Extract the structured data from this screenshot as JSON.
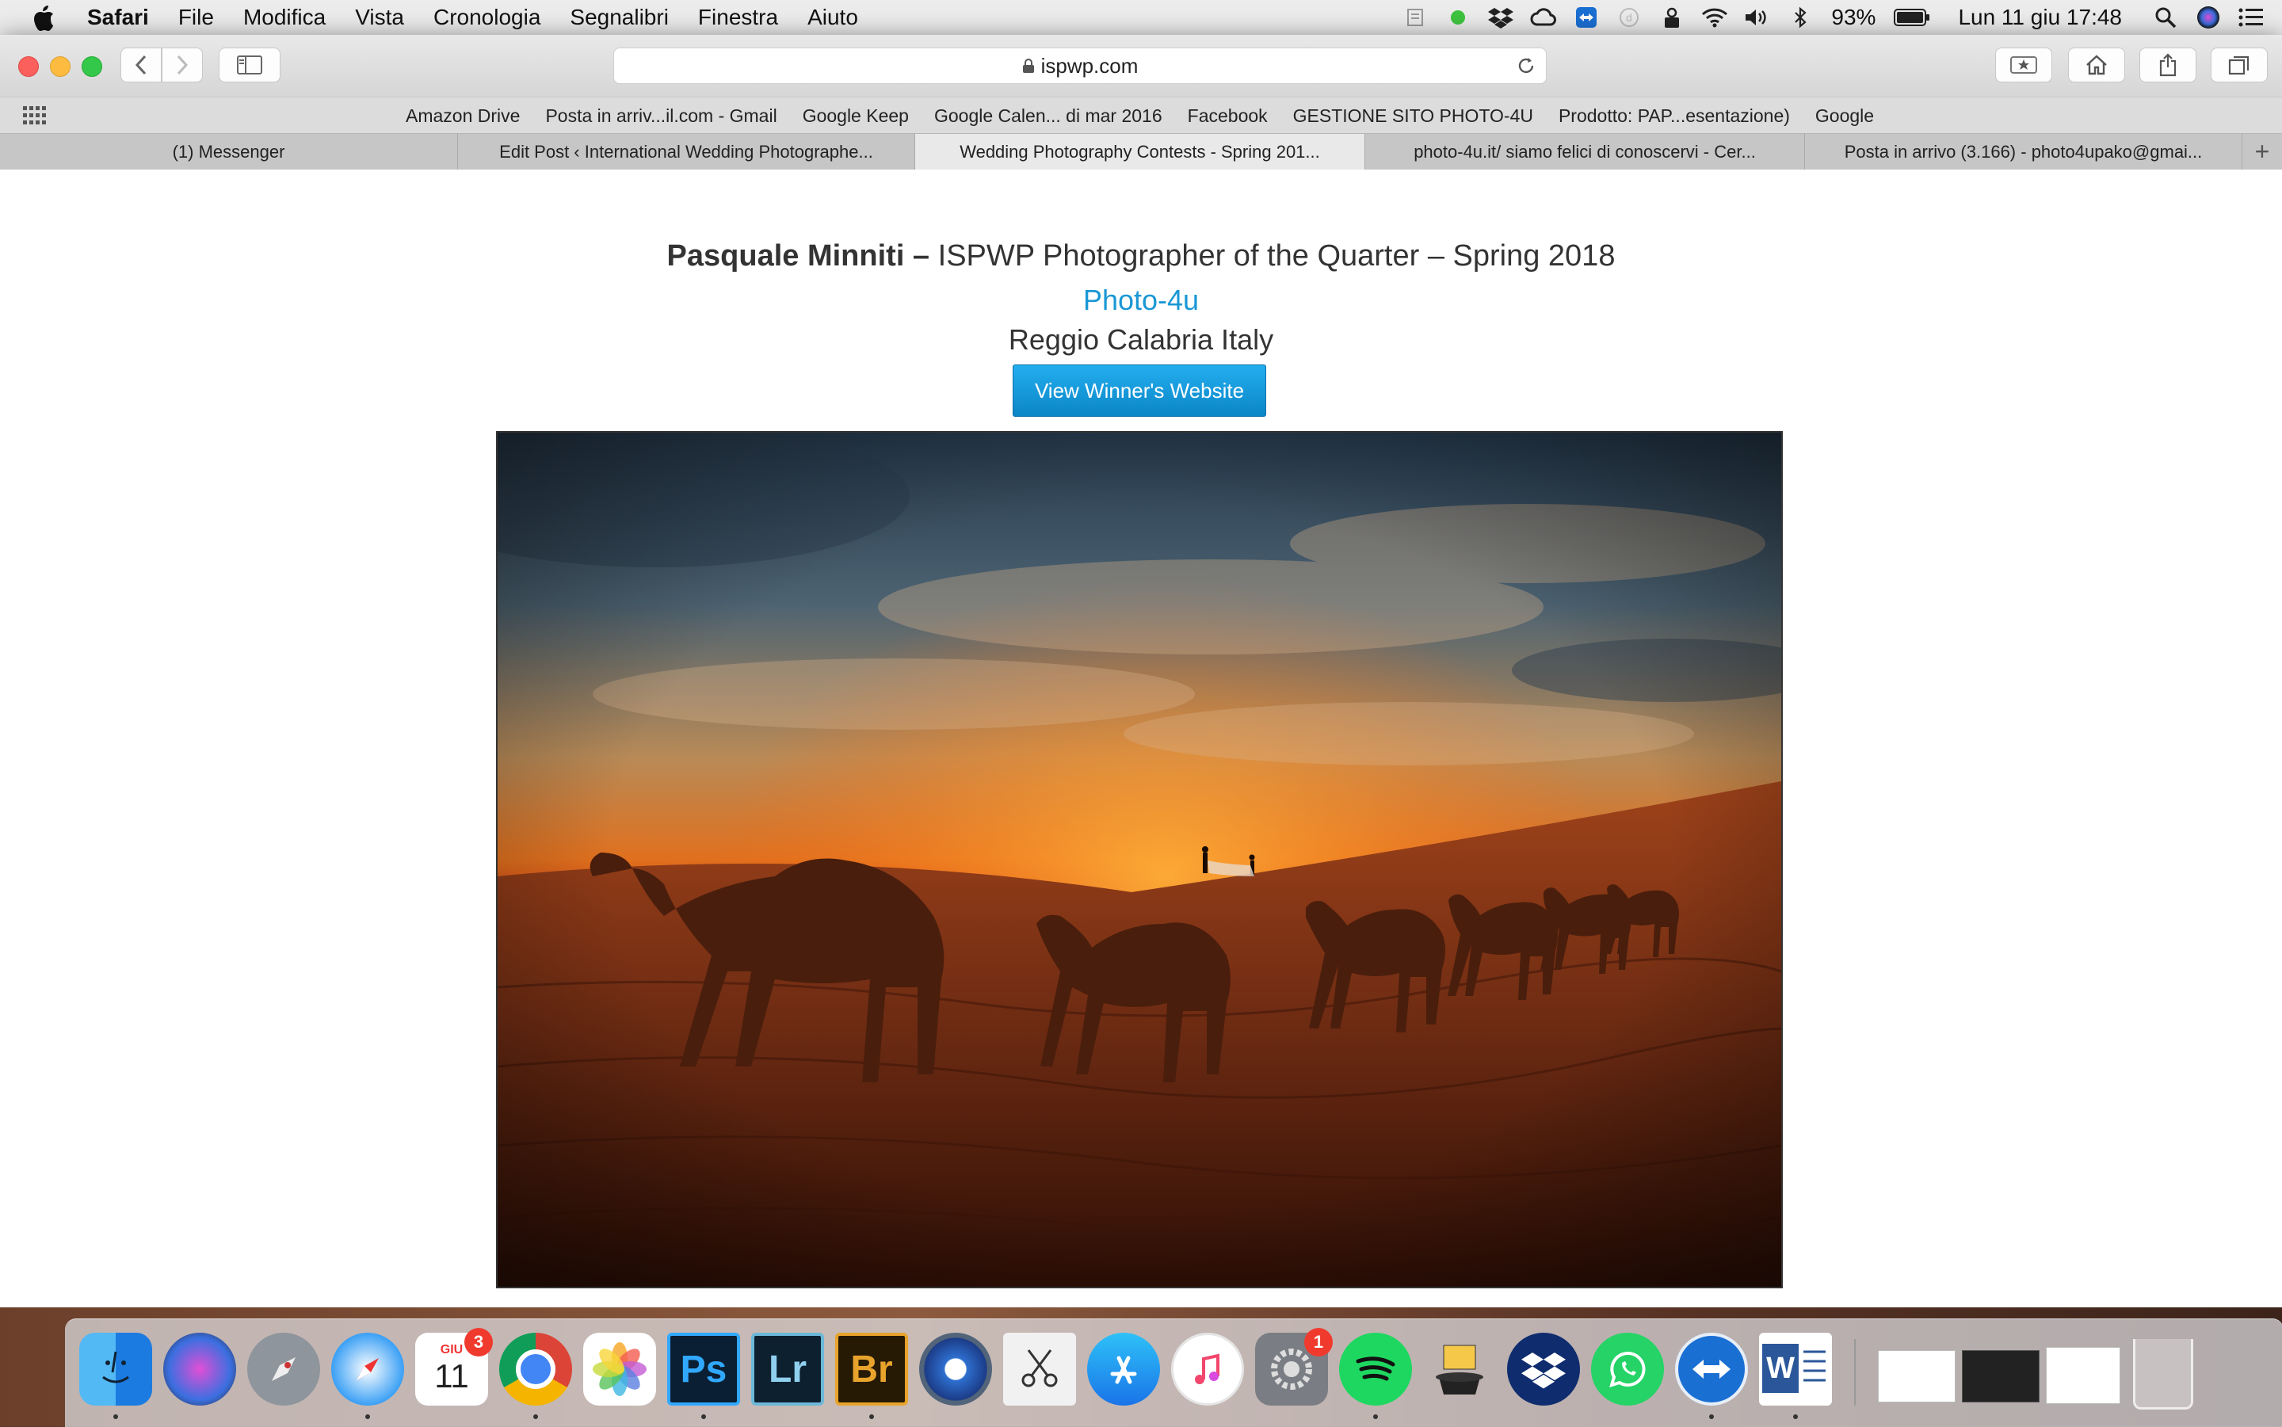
{
  "menubar": {
    "app_name": "Safari",
    "menus": [
      "File",
      "Modifica",
      "Vista",
      "Cronologia",
      "Segnalibri",
      "Finestra",
      "Aiuto"
    ],
    "battery": "93%",
    "clock": "Lun 11 giu 17:48"
  },
  "browser": {
    "address": "ispwp.com",
    "bookmarks": [
      "Amazon Drive",
      "Posta in arriv...il.com - Gmail",
      "Google Keep",
      "Google Calen... di mar 2016",
      "Facebook",
      "GESTIONE SITO PHOTO-4U",
      "Prodotto: PAP...esentazione)",
      "Google"
    ],
    "tabs": [
      {
        "label": "(1) Messenger",
        "active": false
      },
      {
        "label": "Edit Post ‹ International Wedding Photographe...",
        "active": false
      },
      {
        "label": "Wedding Photography Contests - Spring 201...",
        "active": true
      },
      {
        "label": "photo-4u.it/ siamo felici di conoscervi - Cer...",
        "active": false
      },
      {
        "label": "Posta in arrivo (3.166) - photo4upako@gmai...",
        "active": false
      }
    ],
    "new_tab": "+"
  },
  "page": {
    "winner_name": "Pasquale Minniti –",
    "award": " ISPWP Photographer of the Quarter – Spring 2018",
    "studio": "Photo-4u",
    "location": "Reggio Calabria Italy",
    "button_label": "View Winner's Website"
  },
  "dock": {
    "calendar_month": "GIU",
    "calendar_day": "11",
    "calendar_badge": "3",
    "prefs_badge": "1",
    "ps_label": "Ps",
    "lr_label": "Lr",
    "br_label": "Br",
    "word_label": "W"
  },
  "colors": {
    "link": "#1a97d5",
    "button": "#1497da"
  }
}
